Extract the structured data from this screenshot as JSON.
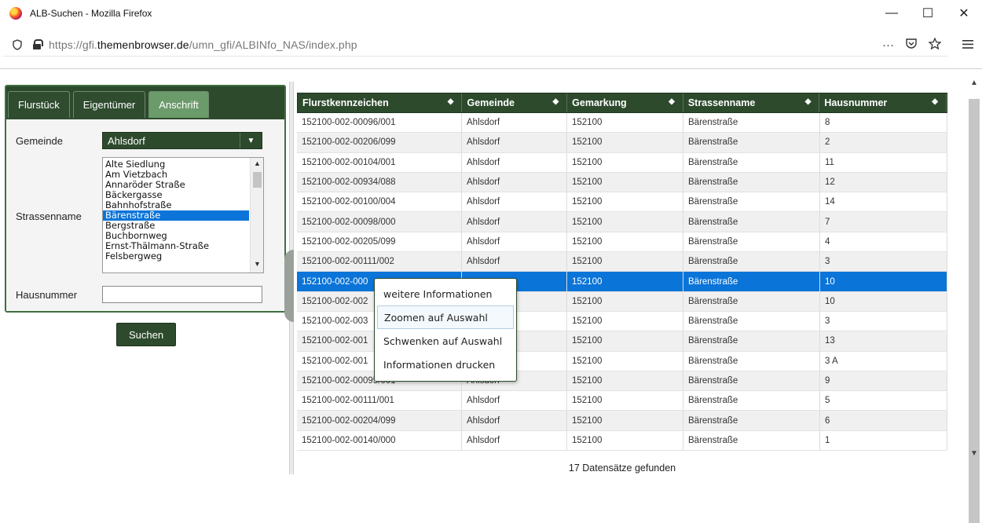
{
  "window": {
    "title": "ALB-Suchen - Mozilla Firefox",
    "controls": {
      "minimize": "—",
      "maximize": "☐",
      "close": "✕"
    }
  },
  "urlbar": {
    "url_prefix": "https://gfi.",
    "url_domain": "themenbrowser.de",
    "url_path": "/umn_gfi/ALBINfo_NAS/index.php",
    "more": "···"
  },
  "tabs": [
    {
      "label": "Flurstück",
      "active": false
    },
    {
      "label": "Eigentümer",
      "active": false
    },
    {
      "label": "Anschrift",
      "active": true
    }
  ],
  "form": {
    "gemeinde_label": "Gemeinde",
    "gemeinde_value": "Ahlsdorf",
    "strassenname_label": "Strassenname",
    "street_options": [
      "Alte Siedlung",
      "Am Vietzbach",
      "Annaröder Straße",
      "Bäckergasse",
      "Bahnhofstraße",
      "Bärenstraße",
      "Bergstraße",
      "Buchbornweg",
      "Ernst-Thälmann-Straße",
      "Felsbergweg"
    ],
    "selected_street_index": 5,
    "hausnummer_label": "Hausnummer",
    "hausnummer_value": "",
    "search_button": "Suchen"
  },
  "grid": {
    "columns": [
      "Flurstkennzeichen",
      "Gemeinde",
      "Gemarkung",
      "Strassenname",
      "Hausnummer"
    ],
    "selected_row": 8,
    "rows": [
      [
        "152100-002-00096/001",
        "Ahlsdorf",
        "152100",
        "Bärenstraße",
        "8"
      ],
      [
        "152100-002-00206/099",
        "Ahlsdorf",
        "152100",
        "Bärenstraße",
        "2"
      ],
      [
        "152100-002-00104/001",
        "Ahlsdorf",
        "152100",
        "Bärenstraße",
        "11"
      ],
      [
        "152100-002-00934/088",
        "Ahlsdorf",
        "152100",
        "Bärenstraße",
        "12"
      ],
      [
        "152100-002-00100/004",
        "Ahlsdorf",
        "152100",
        "Bärenstraße",
        "14"
      ],
      [
        "152100-002-00098/000",
        "Ahlsdorf",
        "152100",
        "Bärenstraße",
        "7"
      ],
      [
        "152100-002-00205/099",
        "Ahlsdorf",
        "152100",
        "Bärenstraße",
        "4"
      ],
      [
        "152100-002-00111/002",
        "Ahlsdorf",
        "152100",
        "Bärenstraße",
        "3"
      ],
      [
        "152100-002-000",
        "",
        "152100",
        "Bärenstraße",
        "10"
      ],
      [
        "152100-002-002",
        "",
        "152100",
        "Bärenstraße",
        "10"
      ],
      [
        "152100-002-003",
        "",
        "152100",
        "Bärenstraße",
        "3"
      ],
      [
        "152100-002-001",
        "",
        "152100",
        "Bärenstraße",
        "13"
      ],
      [
        "152100-002-001",
        "",
        "152100",
        "Bärenstraße",
        "3 A"
      ],
      [
        "152100-002-00095/001",
        "Ahlsdorf",
        "152100",
        "Bärenstraße",
        "9"
      ],
      [
        "152100-002-00111/001",
        "Ahlsdorf",
        "152100",
        "Bärenstraße",
        "5"
      ],
      [
        "152100-002-00204/099",
        "Ahlsdorf",
        "152100",
        "Bärenstraße",
        "6"
      ],
      [
        "152100-002-00140/000",
        "Ahlsdorf",
        "152100",
        "Bärenstraße",
        "1"
      ]
    ],
    "footer": "17 Datensätze gefunden"
  },
  "context_menu": {
    "items": [
      "weitere Informationen",
      "Zoomen auf Auswahl",
      "Schwenken auf Auswahl",
      "Informationen drucken"
    ],
    "hovered_index": 1
  },
  "colors": {
    "theme_green": "#2d4a2d",
    "active_tab": "#6b9a6b",
    "selection_blue": "#0a74d8"
  }
}
